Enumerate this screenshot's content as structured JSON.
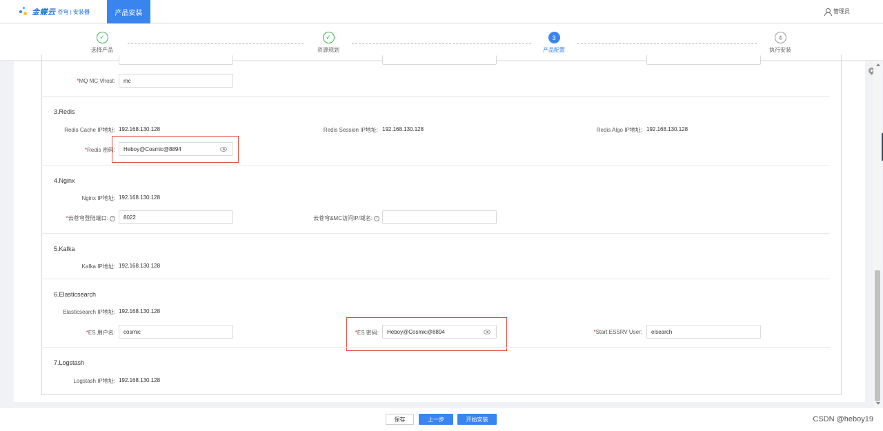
{
  "header": {
    "brand": "金蝶云",
    "brand_sub": "苍穹 | 安装器",
    "active_tab": "产品安装",
    "user": "管理员"
  },
  "steps": [
    {
      "label": "选择产品",
      "state": "done",
      "number": "✓"
    },
    {
      "label": "资源规划",
      "state": "done",
      "number": "✓"
    },
    {
      "label": "产品配置",
      "state": "active",
      "number": "3"
    },
    {
      "label": "执行安装",
      "state": "todo",
      "number": "4"
    }
  ],
  "mq": {
    "vhost_label": "MQ MC Vhost:",
    "vhost_value": "mc"
  },
  "redis": {
    "title": "3.Redis",
    "cache_label": "Redis Cache IP地址:",
    "cache_value": "192.168.130.128",
    "session_label": "Redis Session IP地址:",
    "session_value": "192.168.130.128",
    "algo_label": "Redis Algo IP地址:",
    "algo_value": "192.168.130.128",
    "password_label": "Redis 密码:",
    "password_value": "Heboy@Cosmic@8894"
  },
  "nginx": {
    "title": "4.Nginx",
    "ip_label": "Nginx IP地址:",
    "ip_value": "192.168.130.128",
    "port_label": "云苍穹登陆端口:",
    "port_value": "8022",
    "domain_label": "云苍穹&MC访问IP/域名:",
    "domain_value": ""
  },
  "kafka": {
    "title": "5.Kafka",
    "ip_label": "Kafka IP地址:",
    "ip_value": "192.168.130.128"
  },
  "es": {
    "title": "6.Elasticsearch",
    "ip_label": "Elasticsearch IP地址:",
    "ip_value": "192.168.130.128",
    "user_label": "ES 用户名:",
    "user_value": "cosmic",
    "password_label": "ES 密码:",
    "password_value": "Heboy@Cosmic@8894",
    "essrv_label": "Start ESSRV User:",
    "essrv_value": "elsearch"
  },
  "logstash": {
    "title": "7.Logstash",
    "ip_label": "Logstash IP地址:",
    "ip_value": "192.168.130.128"
  },
  "footer": {
    "save": "保存",
    "prev": "上一步",
    "start": "开始安装",
    "watermark": "CSDN @heboy19"
  },
  "required_mark": "*",
  "help_mark": "?"
}
